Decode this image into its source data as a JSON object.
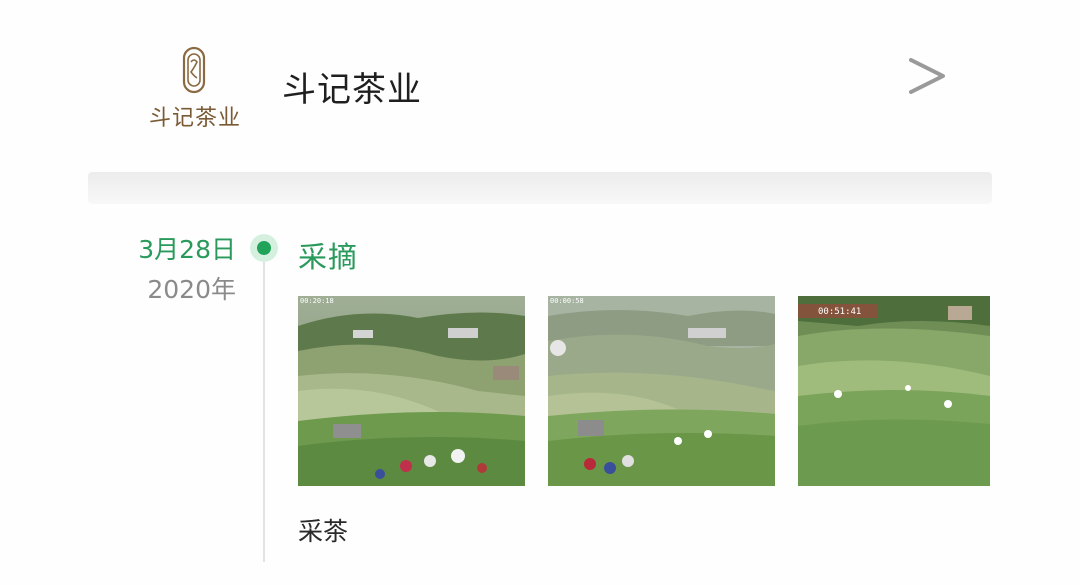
{
  "header": {
    "logo_text": "斗记茶业",
    "brand_name": "斗记茶业",
    "chevron_icon": "chevron-right-icon"
  },
  "timeline": {
    "entries": [
      {
        "date": "3月28日",
        "year": "2020年",
        "title": "采摘",
        "photos": [
          {
            "timestamp": "00:20:18"
          },
          {
            "timestamp": "00:00:58"
          },
          {
            "timestamp": "00:51:41"
          }
        ],
        "caption": "采茶"
      }
    ]
  },
  "colors": {
    "accent_green": "#2a9a5c",
    "logo_brown": "#7a5a34",
    "muted_gray": "#8a8a8a"
  }
}
